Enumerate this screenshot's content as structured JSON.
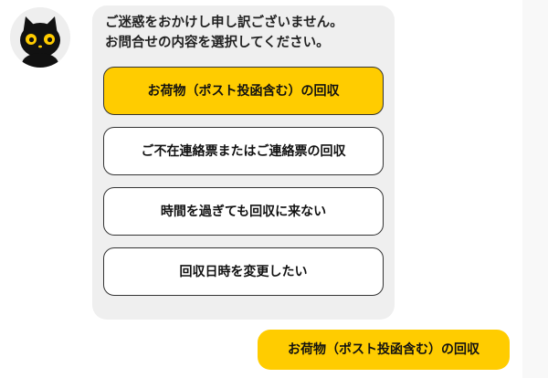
{
  "bot": {
    "avatar_icon": "black-cat-icon",
    "message": "ご迷惑をおかけし申し訳ございません。\nお問合せの内容を選択してください。",
    "options": [
      {
        "label": "お荷物（ポスト投函含む）の回収",
        "selected": true
      },
      {
        "label": "ご不在連絡票またはご連絡票の回収",
        "selected": false
      },
      {
        "label": "時間を過ぎても回収に来ない",
        "selected": false
      },
      {
        "label": "回収日時を変更したい",
        "selected": false
      }
    ]
  },
  "user": {
    "reply": "お荷物（ポスト投函含む）の回収"
  },
  "colors": {
    "accent": "#ffcc00",
    "bubble_gray": "#efefef",
    "border": "#333333"
  }
}
